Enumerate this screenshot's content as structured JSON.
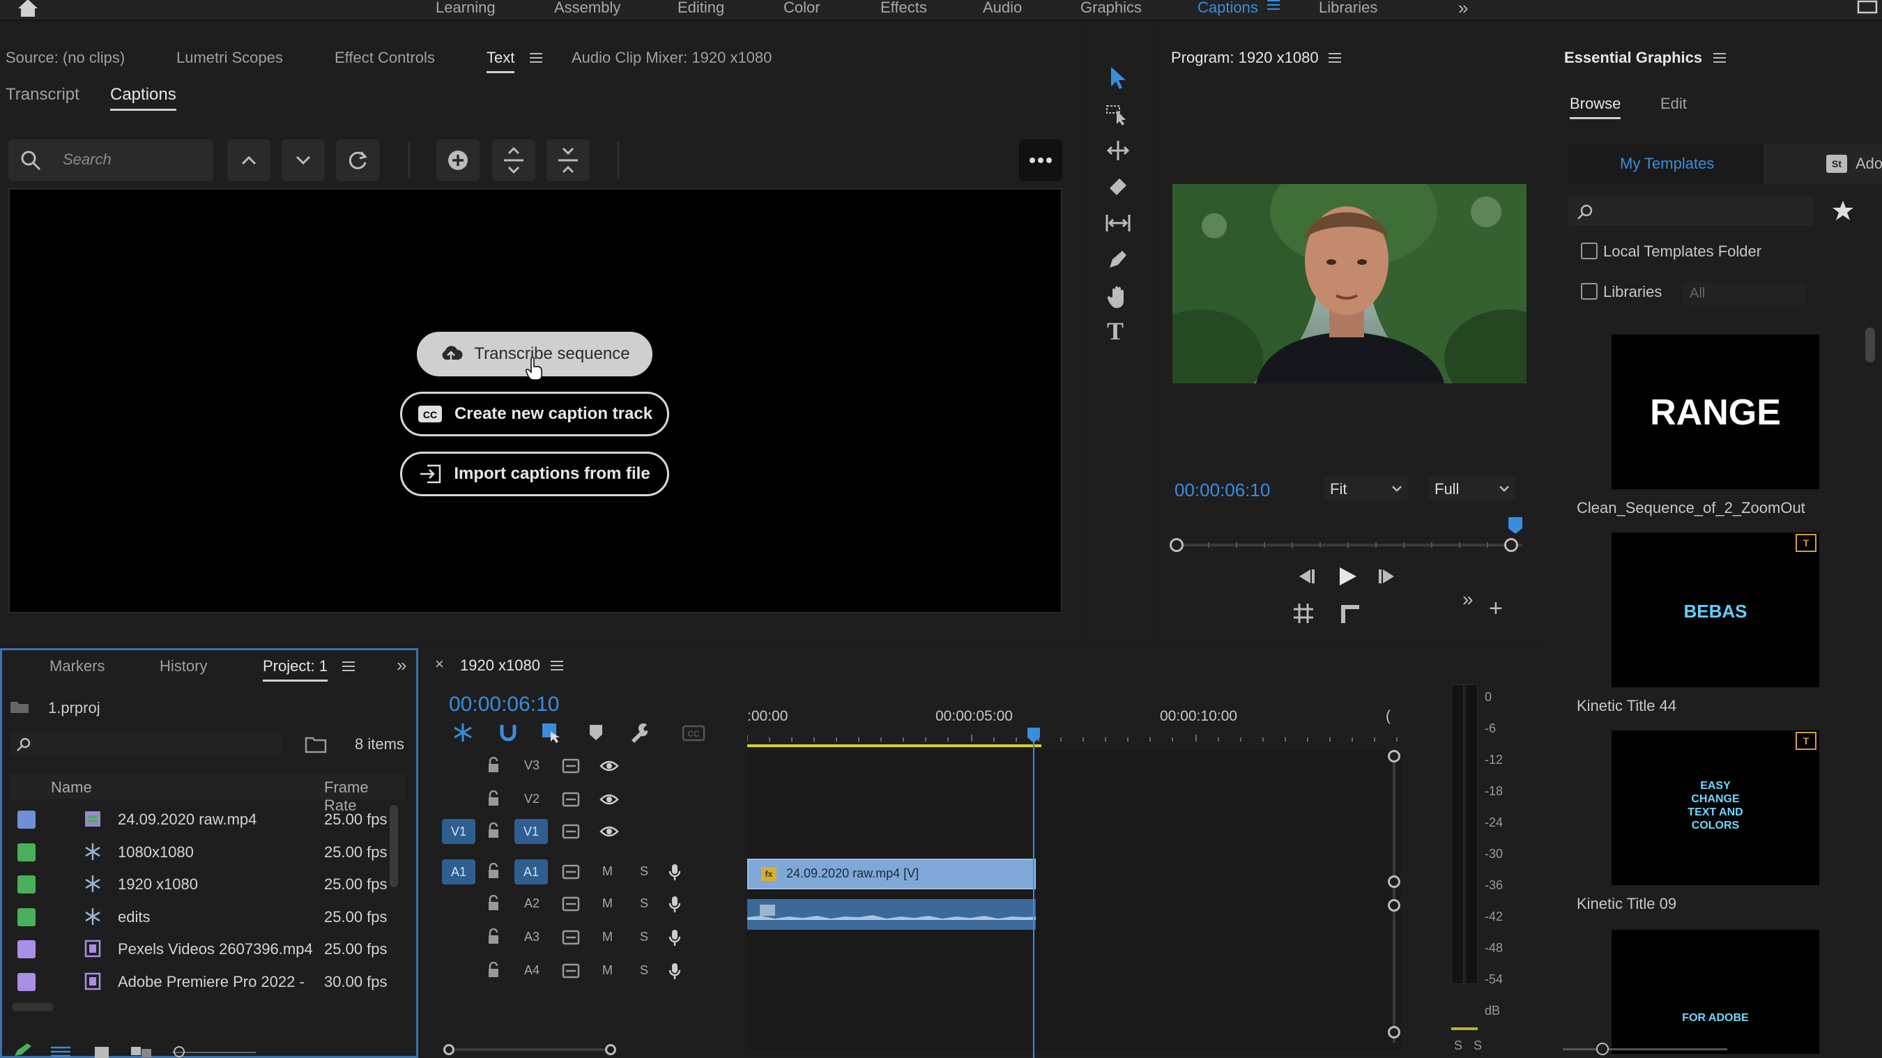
{
  "workspaces": [
    "Learning",
    "Assembly",
    "Editing",
    "Color",
    "Effects",
    "Audio",
    "Graphics",
    "Captions",
    "Libraries"
  ],
  "active_workspace": "Captions",
  "source_panel": {
    "tabs": [
      "Source: (no clips)",
      "Lumetri Scopes",
      "Effect Controls",
      "Text",
      "Audio Clip Mixer: 1920 x1080"
    ],
    "active_tab": "Text",
    "subtabs": [
      "Transcript",
      "Captions"
    ],
    "active_subtab": "Captions",
    "search_placeholder": "Search",
    "buttons": {
      "transcribe": "Transcribe sequence",
      "create_track": "Create new caption track",
      "import": "Import captions from file"
    }
  },
  "program_monitor": {
    "title": "Program: 1920 x1080",
    "timecode": "00:00:06:10",
    "fit": "Fit",
    "quality": "Full",
    "playhead_fraction": 0.98
  },
  "essential_graphics": {
    "title": "Essential Graphics",
    "tabs": [
      "Browse",
      "Edit"
    ],
    "active_tab": "Browse",
    "source_tabs": [
      "My Templates",
      "Adob"
    ],
    "local_folder_label": "Local Templates Folder",
    "libraries_label": "Libraries",
    "libraries_value": "All",
    "templates": [
      {
        "name": "Clean_Sequence_of_2_ZoomOut",
        "preview_text": "RANGE"
      },
      {
        "name": "Kinetic Title 44",
        "preview_text": "BEBAS"
      },
      {
        "name": "Kinetic Title 09",
        "preview_text": "EASY CHANGE TEXT AND COLORS"
      },
      {
        "name": "",
        "preview_text": "FOR ADOBE"
      }
    ]
  },
  "project_panel": {
    "tabs": [
      "Markers",
      "History",
      "Project: 1"
    ],
    "active_tab": "Project: 1",
    "file": "1.prproj",
    "item_count": "8 items",
    "columns": [
      "Name",
      "Frame Rate"
    ],
    "items": [
      {
        "name": "24.09.2020 raw.mp4",
        "rate": "25.00 fps",
        "color": "#6f8fd6",
        "icon": "video-audio-clip-icon"
      },
      {
        "name": "1080x1080",
        "rate": "25.00 fps",
        "color": "#48b05a",
        "icon": "sequence-icon"
      },
      {
        "name": "1920 x1080",
        "rate": "25.00 fps",
        "color": "#48b05a",
        "icon": "sequence-icon"
      },
      {
        "name": "edits",
        "rate": "25.00 fps",
        "color": "#48b05a",
        "icon": "sequence-icon"
      },
      {
        "name": "Pexels Videos 2607396.mp4",
        "rate": "25.00 fps",
        "color": "#a98ee6",
        "icon": "video-clip-icon"
      },
      {
        "name": "Adobe Premiere Pro 2022 -",
        "rate": "30.00 fps",
        "color": "#a98ee6",
        "icon": "video-clip-icon"
      }
    ]
  },
  "timeline": {
    "sequence_name": "1920 x1080",
    "timecode": "00:00:06:10",
    "ruler": [
      ":00:00",
      "00:00:05:00",
      "00:00:10:00",
      "("
    ],
    "tracks": [
      {
        "src": "",
        "name": "V3",
        "kind": "video"
      },
      {
        "src": "",
        "name": "V2",
        "kind": "video"
      },
      {
        "src": "V1",
        "name": "V1",
        "kind": "video"
      },
      {
        "src": "A1",
        "name": "A1",
        "kind": "audio"
      },
      {
        "src": "",
        "name": "A2",
        "kind": "audio"
      },
      {
        "src": "",
        "name": "A3",
        "kind": "audio"
      },
      {
        "src": "",
        "name": "A4",
        "kind": "audio"
      }
    ],
    "mute_label": "M",
    "solo_label": "S",
    "clip_label": "24.09.2020 raw.mp4 [V]"
  },
  "audio_meter": {
    "labels": [
      "0",
      "-6",
      "-12",
      "-18",
      "-24",
      "-30",
      "-36",
      "-42",
      "-48",
      "-54",
      "dB"
    ],
    "solo_buttons": [
      "S",
      "S"
    ]
  },
  "colors": {
    "accent": "#3a8dde",
    "panel": "#1e1e1e",
    "clip_video": "#7fa8d8",
    "clip_audio": "#3b6a99",
    "playhead": "#3a8dde"
  }
}
